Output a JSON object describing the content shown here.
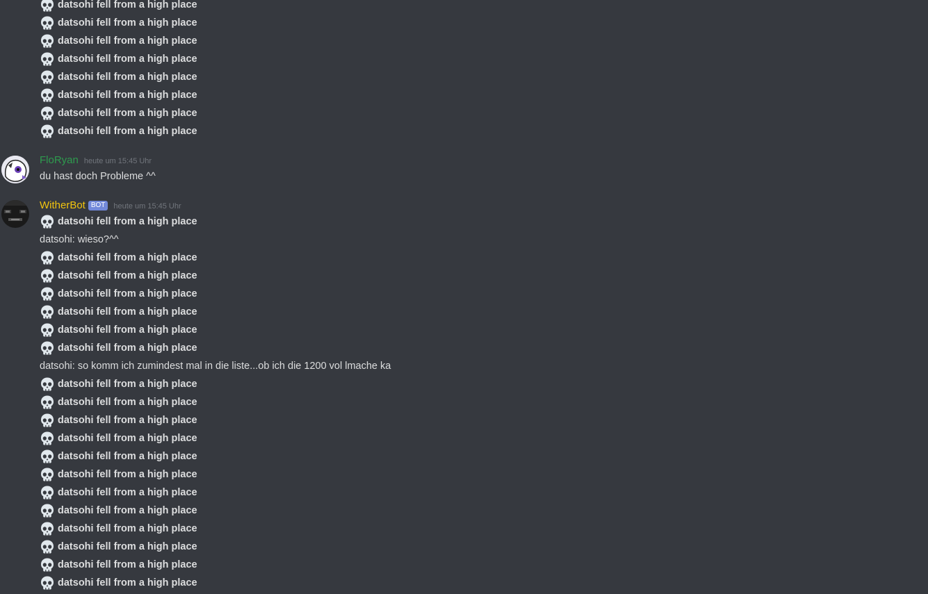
{
  "death_message": "datsohi fell from a high place",
  "death_icon": "skull-icon",
  "colors": {
    "background": "#36393f",
    "text": "#dcddde",
    "timestamp": "#72767d",
    "florian_name": "#2e9b4e",
    "witherbot_name": "#f1c40f",
    "bot_badge": "#7289da"
  },
  "group_top": {
    "death_count": 8
  },
  "florian": {
    "username": "FloRyan",
    "timestamp": "heute um 15:45 Uhr",
    "message": "du hast doch Probleme ^^"
  },
  "witherbot": {
    "username": "WitherBot",
    "badge": "BOT",
    "timestamp": "heute um 15:45 Uhr",
    "lines": [
      {
        "type": "death"
      },
      {
        "type": "chat",
        "text": "datsohi: wieso?^^"
      },
      {
        "type": "death"
      },
      {
        "type": "death"
      },
      {
        "type": "death"
      },
      {
        "type": "death"
      },
      {
        "type": "death"
      },
      {
        "type": "death"
      },
      {
        "type": "chat",
        "text": "datsohi: so komm ich zumindest mal in die liste...ob ich die 1200 vol lmache ka"
      },
      {
        "type": "death"
      },
      {
        "type": "death"
      },
      {
        "type": "death"
      },
      {
        "type": "death"
      },
      {
        "type": "death"
      },
      {
        "type": "death"
      },
      {
        "type": "death"
      },
      {
        "type": "death"
      },
      {
        "type": "death"
      },
      {
        "type": "death"
      },
      {
        "type": "death"
      },
      {
        "type": "death"
      }
    ]
  }
}
